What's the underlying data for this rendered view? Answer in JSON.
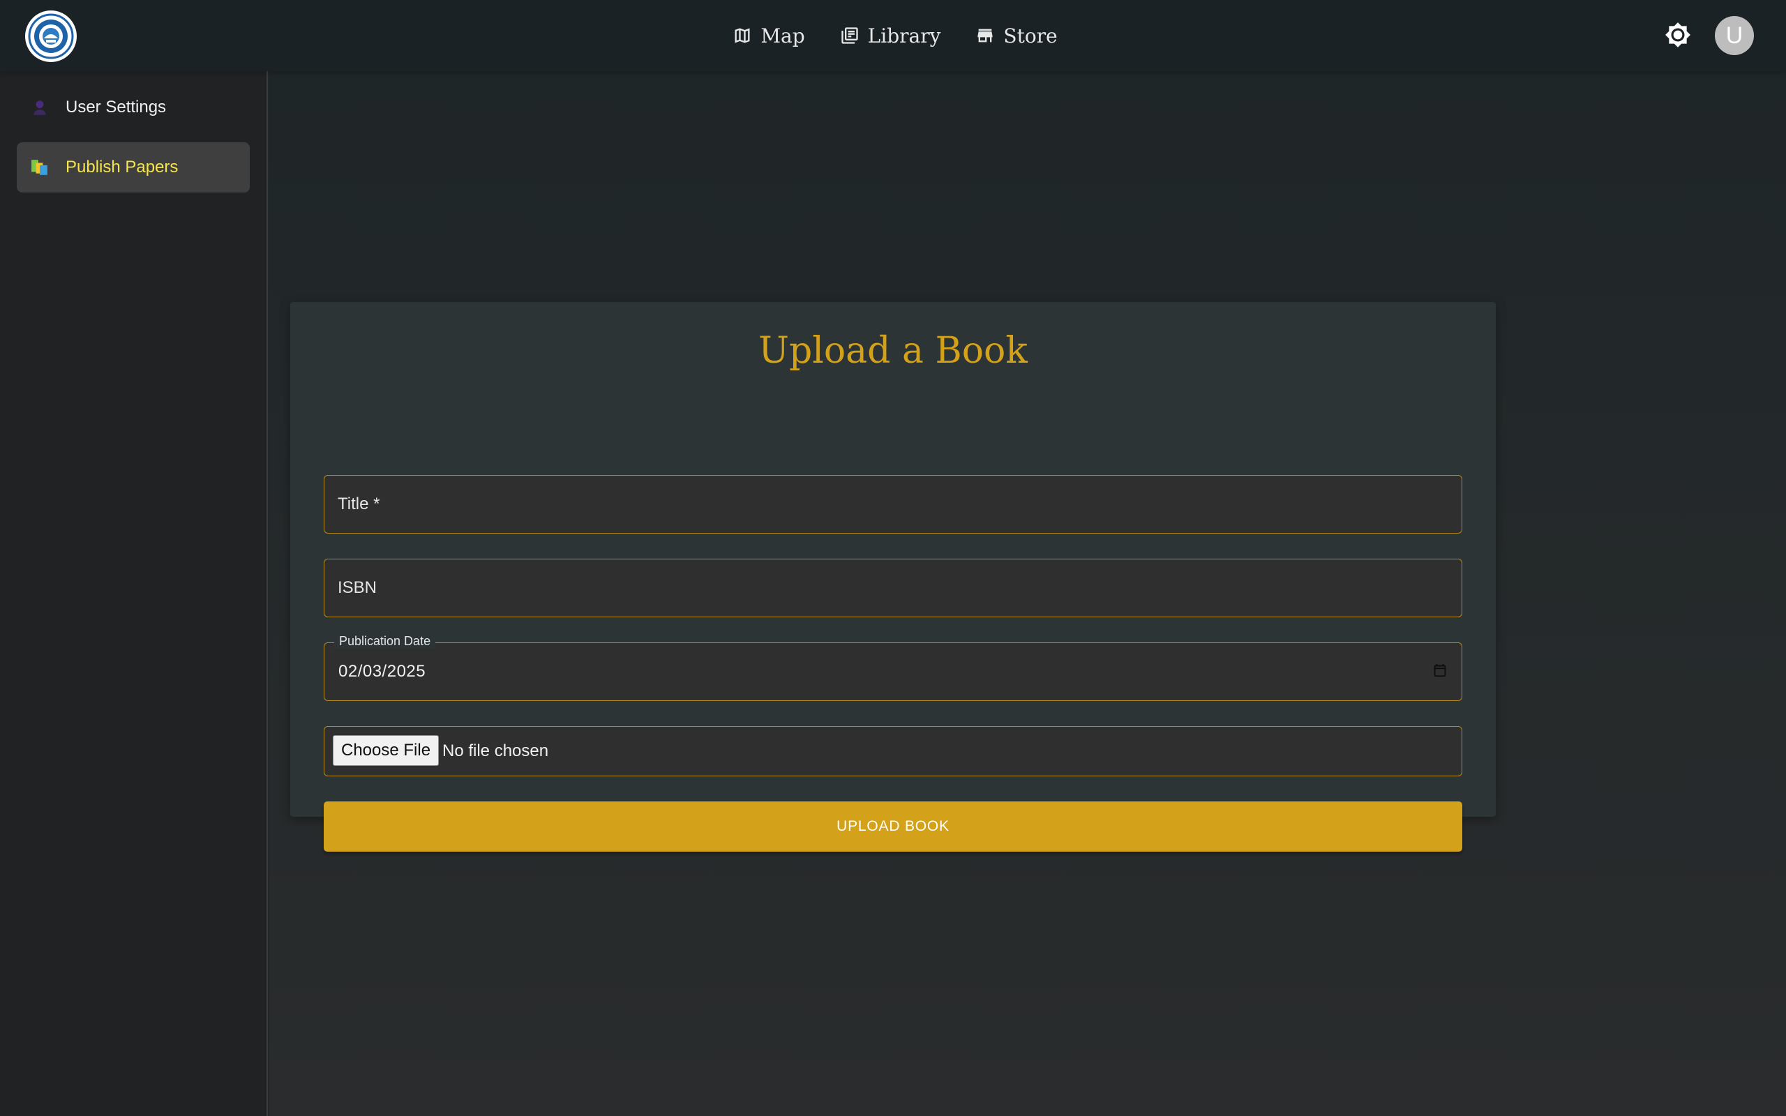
{
  "header": {
    "logo_icon": "seal-logo-icon",
    "nav": [
      {
        "label": "Map",
        "icon": "map-icon"
      },
      {
        "label": "Library",
        "icon": "library-icon"
      },
      {
        "label": "Store",
        "icon": "store-icon"
      }
    ],
    "theme_icon": "brightness-icon",
    "avatar_letter": "U"
  },
  "sidebar": {
    "items": [
      {
        "label": "User Settings",
        "icon": "user-icon",
        "active": false
      },
      {
        "label": "Publish Papers",
        "icon": "papers-icon",
        "active": true
      }
    ]
  },
  "form": {
    "title": "Upload a Book",
    "fields": {
      "title_placeholder": "Title *",
      "isbn_placeholder": "ISBN",
      "date_label": "Publication Date",
      "date_value": "02/03/2025",
      "file_button": "Choose File",
      "file_status": "No file chosen"
    },
    "submit_label": "UPLOAD BOOK"
  },
  "colors": {
    "accent": "#d4a11a",
    "active_text": "#f5e44a",
    "topbar": "#1b2225",
    "sidebar": "#212224",
    "card": "#2c3436"
  }
}
